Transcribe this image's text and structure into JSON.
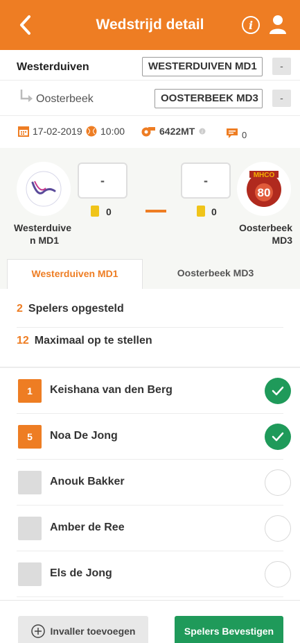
{
  "header": {
    "title": "Wedstrijd detail",
    "back_icon": "chevron-left-icon",
    "info_icon": "info-icon",
    "user_icon": "user-icon"
  },
  "teams": {
    "home": {
      "name": "Westerduiven",
      "box": "WESTERDUIVEN MD1",
      "dash": "-"
    },
    "away": {
      "name": "Oosterbeek",
      "box": "OOSTERBEEK MD3",
      "dash": "-"
    }
  },
  "info": {
    "date": "17-02-2019",
    "time": "10:00",
    "field": "6422MT",
    "comments": "0"
  },
  "score": {
    "home": {
      "value": "-",
      "cards": "0",
      "label_line1": "Westerduive",
      "label_line2": "n MD1"
    },
    "away": {
      "value": "-",
      "cards": "0",
      "label_line1": "Oosterbeek",
      "label_line2": "MD3",
      "logo_text_top": "MHCO",
      "logo_text_num": "80"
    }
  },
  "tabs": {
    "active": "Westerduiven MD1",
    "inactive": "Oosterbeek MD3"
  },
  "stats": [
    {
      "num": "2",
      "label": "Spelers opgesteld"
    },
    {
      "num": "12",
      "label": "Maximaal op te stellen"
    }
  ],
  "players": [
    {
      "shirt": "1",
      "name": "Keishana van den Berg",
      "selected": true
    },
    {
      "shirt": "5",
      "name": "Noa De Jong",
      "selected": true
    },
    {
      "shirt": "",
      "name": "Anouk Bakker",
      "selected": false
    },
    {
      "shirt": "",
      "name": "Amber de Ree",
      "selected": false
    },
    {
      "shirt": "",
      "name": "Els de Jong",
      "selected": false
    }
  ],
  "buttons": {
    "add_sub": "Invaller toevoegen",
    "confirm": "Spelers Bevestigen"
  },
  "colors": {
    "accent": "#ee7d23",
    "confirm": "#1f9a5a"
  }
}
